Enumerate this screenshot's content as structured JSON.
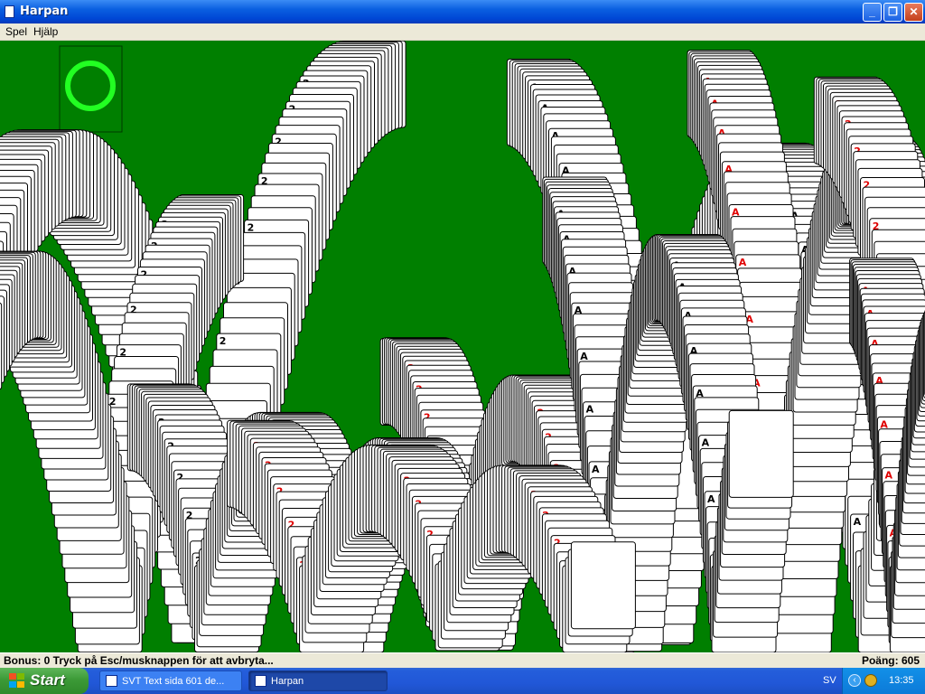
{
  "window": {
    "title": "Harpan",
    "minimize_glyph": "_",
    "maximize_glyph": "❐",
    "close_glyph": "✕"
  },
  "menu": [
    "Spel",
    "Hjälp"
  ],
  "status": {
    "left": "Bonus: 0  Tryck på Esc/musknappen för att avbryta...",
    "right": "Poäng: 605"
  },
  "taskbar": {
    "start_label": "Start",
    "tasks": [
      {
        "label": "SVT Text sida 601 de...",
        "active": false
      },
      {
        "label": "Harpan",
        "active": true
      }
    ],
    "language": "SV",
    "clock": "13:35"
  },
  "game": {
    "background_color": "#007f00",
    "empty_slot_ring_color": "#22ff22",
    "card_glyphs": [
      "2",
      "A"
    ],
    "suit_colors": {
      "black": "#000000",
      "red": "#e00000"
    }
  },
  "colors": {
    "title_blue": "#0a5fe0",
    "taskbar_blue": "#245edb",
    "start_green": "#3c9a37"
  }
}
